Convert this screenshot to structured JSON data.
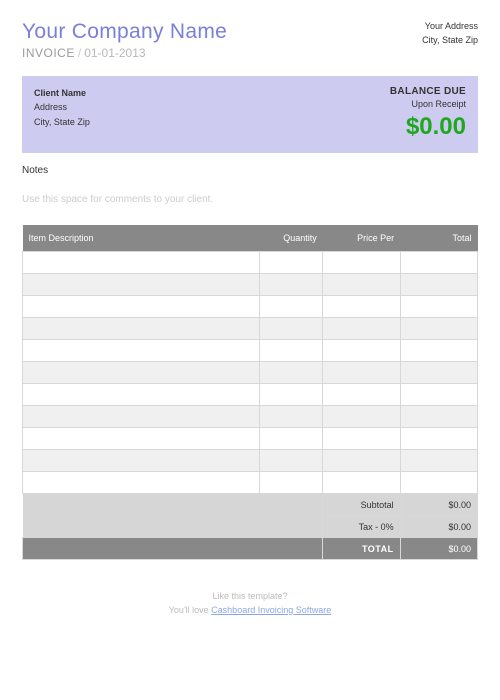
{
  "header": {
    "company_name": "Your Company Name",
    "invoice_label": "INVOICE",
    "invoice_date": "01-01-2013",
    "your_address": "Your Address",
    "your_city_state_zip": "City, State Zip"
  },
  "client": {
    "name": "Client Name",
    "address": "Address",
    "city_state_zip": "City, State Zip",
    "balance_due_label": "BALANCE DUE",
    "terms": "Upon Receipt",
    "amount": "$0.00"
  },
  "notes": {
    "label": "Notes",
    "placeholder": "Use this space for comments to your client."
  },
  "table": {
    "headers": {
      "description": "Item Description",
      "quantity": "Quantity",
      "price_per": "Price Per",
      "total": "Total"
    },
    "subtotal_label": "Subtotal",
    "subtotal_value": "$0.00",
    "tax_label": "Tax - 0%",
    "tax_value": "$0.00",
    "total_label": "TOTAL",
    "total_value": "$0.00"
  },
  "footer": {
    "line1": "Like this template?",
    "line2_prefix": "You'll love ",
    "link_text": "Cashboard Invoicing Software"
  }
}
